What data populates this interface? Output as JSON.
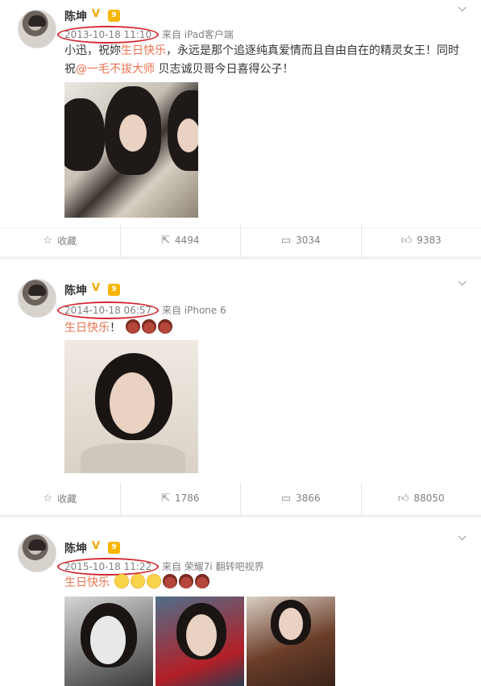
{
  "posts": [
    {
      "author": "陈坤",
      "verified": "V",
      "vip": "9",
      "timestamp": "2013-10-18 11:10",
      "source": "来自 iPad客户端",
      "text_before": "小迅，祝妳",
      "text_highlight": "生日快乐",
      "text_middle": "，永远是那个追逐纯真爱情而且自由自在的精灵女王！同时祝",
      "mention": "@一毛不拔大师",
      "text_after": " 贝志诚贝哥今日喜得公子！",
      "actions": {
        "favorite": "收藏",
        "reposts": "4494",
        "comments": "3034",
        "likes": "9383"
      }
    },
    {
      "author": "陈坤",
      "verified": "V",
      "vip": "9",
      "timestamp": "2014-10-18 06:57",
      "source": "来自 iPhone 6",
      "text_highlight": "生日快乐",
      "text_after": "！",
      "actions": {
        "favorite": "收藏",
        "reposts": "1786",
        "comments": "3866",
        "likes": "88050"
      }
    },
    {
      "author": "陈坤",
      "verified": "V",
      "vip": "9",
      "timestamp": "2015-10-18 11:22",
      "source": "来自 荣耀7i 翻转吧视界",
      "text_highlight": "生日快乐"
    }
  ],
  "icons": {
    "chevron": "chevron-down-icon",
    "favorite": "star-icon",
    "repost": "repost-icon",
    "comment": "comment-icon",
    "like": "thumbs-up-icon"
  },
  "colors": {
    "accent": "#eb7350",
    "circle": "#d3262d",
    "vip": "#f7b500"
  }
}
